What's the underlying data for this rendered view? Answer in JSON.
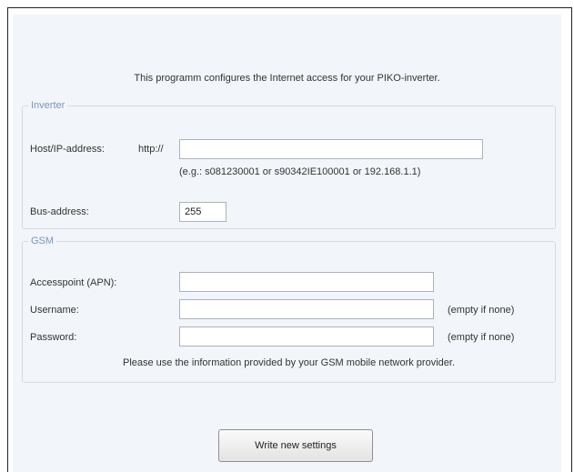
{
  "intro": "This programm configures the Internet access for your PIKO-inverter.",
  "inverter": {
    "legend": "Inverter",
    "host_label": "Host/IP-address:",
    "http_prefix": "http://",
    "host_value": "",
    "host_hint": "(e.g.: s081230001 or s90342IE100001 or 192.168.1.1)",
    "bus_label": "Bus-address:",
    "bus_value": "255"
  },
  "gsm": {
    "legend": "GSM",
    "apn_label": "Accesspoint (APN):",
    "apn_value": "",
    "username_label": "Username:",
    "username_value": "",
    "username_hint": "(empty if none)",
    "password_label": "Password:",
    "password_value": "",
    "password_hint": "(empty if none)",
    "note": "Please use the information provided by your GSM mobile network provider."
  },
  "submit_label": "Write new settings"
}
